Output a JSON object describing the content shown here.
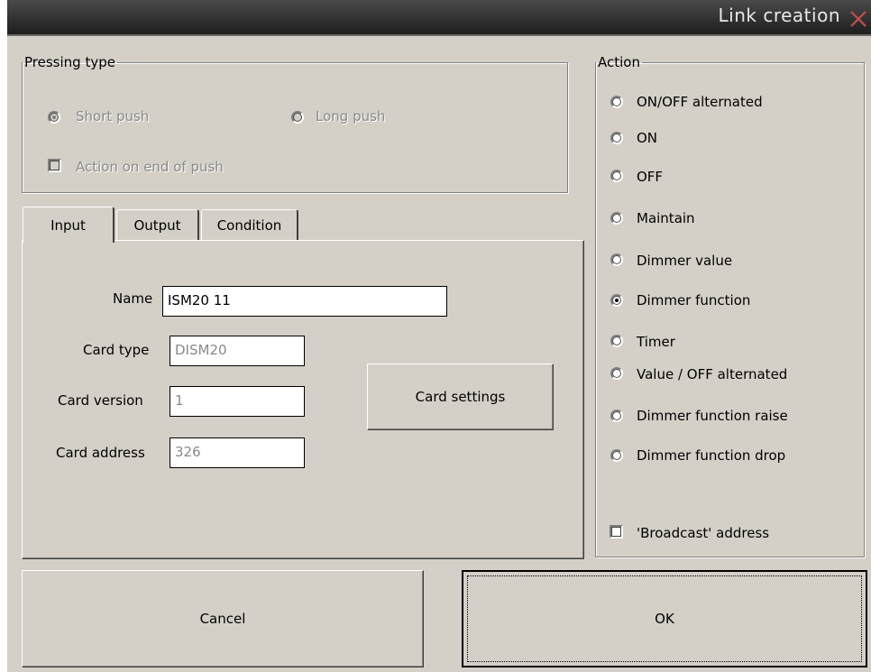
{
  "window": {
    "title": "Link creation",
    "close_icon": "close-icon"
  },
  "pressing_type": {
    "legend": "Pressing type",
    "short_push": "Short push",
    "long_push": "Long push",
    "action_on_end": "Action on end of push",
    "selected": "Short push"
  },
  "tabs": [
    {
      "label": "Input"
    },
    {
      "label": "Output"
    },
    {
      "label": "Condition"
    }
  ],
  "active_tab": "Input",
  "input": {
    "name_label": "Name",
    "name_value": "ISM20 11",
    "card_type_label": "Card type",
    "card_type_value": "DISM20",
    "card_version_label": "Card version",
    "card_version_value": "1",
    "card_address_label": "Card address",
    "card_address_value": "326",
    "card_settings_button": "Card settings"
  },
  "action": {
    "legend": "Action",
    "options": [
      {
        "label": "ON/OFF alternated"
      },
      {
        "label": "ON"
      },
      {
        "label": "OFF"
      },
      {
        "label": "Maintain"
      },
      {
        "label": "Dimmer value"
      },
      {
        "label": "Dimmer function"
      },
      {
        "label": "Timer"
      },
      {
        "label": "Value / OFF alternated"
      },
      {
        "label": "Dimmer function raise"
      },
      {
        "label": "Dimmer function drop"
      }
    ],
    "selected": "Dimmer function",
    "broadcast_label": "'Broadcast' address",
    "broadcast_checked": false
  },
  "buttons": {
    "cancel": "Cancel",
    "ok": "OK"
  },
  "colors": {
    "face": "#d4d0c8",
    "titlebar": "#2a2a2a",
    "close": "#c0504d"
  }
}
